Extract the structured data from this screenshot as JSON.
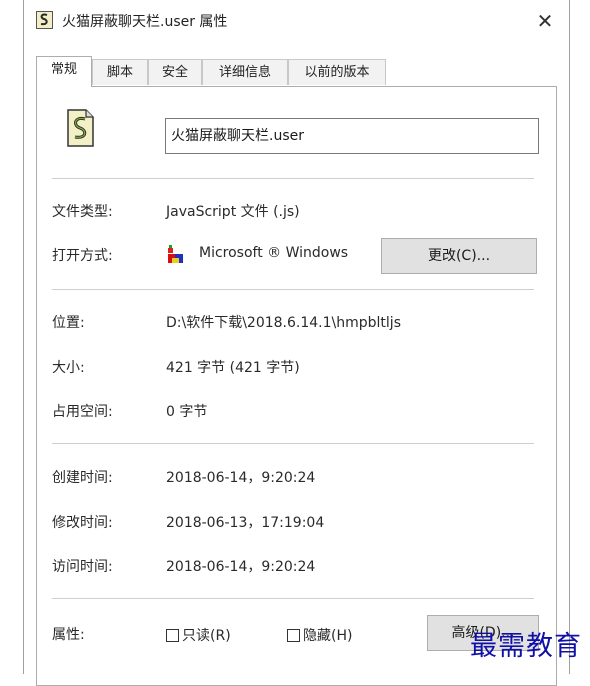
{
  "window": {
    "title": "火猫屏蔽聊天栏.user 属性",
    "close_glyph": "✕",
    "title_icon": "script-file-icon"
  },
  "tabs": [
    {
      "label": "常规",
      "active": true
    },
    {
      "label": "脚本",
      "active": false
    },
    {
      "label": "安全",
      "active": false
    },
    {
      "label": "详细信息",
      "active": false
    },
    {
      "label": "以前的版本",
      "active": false
    }
  ],
  "general": {
    "file_icon": "javascript-file-icon",
    "file_name": "火猫屏蔽聊天栏.user",
    "type_label": "文件类型:",
    "type_value": "JavaScript 文件 (.js)",
    "open_label": "打开方式:",
    "open_value": "Microsoft ® Windows",
    "open_icon": "windows-script-host-icon",
    "change_button": "更改(C)...",
    "location_label": "位置:",
    "location_value": "D:\\软件下载\\2018.6.14.1\\hmpbltljs",
    "size_label": "大小:",
    "size_value": "421 字节 (421 字节)",
    "disk_label": "占用空间:",
    "disk_value": "0 字节",
    "created_label": "创建时间:",
    "created_value": "2018-06-14，9:20:24",
    "modified_label": "修改时间:",
    "modified_value": "2018-06-13，17:19:04",
    "accessed_label": "访问时间:",
    "accessed_value": "2018-06-14，9:20:24",
    "attr_label": "属性:",
    "readonly_label": "只读(R)",
    "readonly_checked": false,
    "hidden_label": "隐藏(H)",
    "hidden_checked": false,
    "advanced_button": "高级(D)..."
  },
  "watermark": "最需教育",
  "colors": {
    "tab_inactive": "#f2f2f2",
    "button_face": "#e1e1e1",
    "watermark": "#1010a8"
  }
}
